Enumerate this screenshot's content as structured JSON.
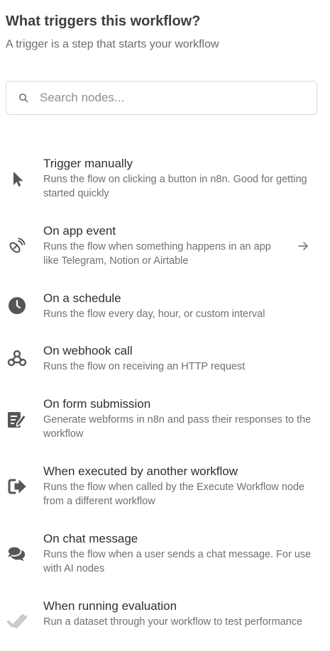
{
  "header": {
    "title": "What triggers this workflow?",
    "subtitle": "A trigger is a step that starts your workflow"
  },
  "search": {
    "placeholder": "Search nodes...",
    "value": "",
    "icon": "search-icon"
  },
  "triggers": [
    {
      "title": "Trigger manually",
      "description": "Runs the flow on clicking a button in n8n. Good for getting started quickly",
      "icon": "cursor-pointer-icon"
    },
    {
      "title": "On app event",
      "description": "Runs the flow when something happens in an app like Telegram, Notion or Airtable",
      "icon": "satellite-dish-icon",
      "has_arrow": true
    },
    {
      "title": "On a schedule",
      "description": "Runs the flow every day, hour, or custom interval",
      "icon": "clock-icon"
    },
    {
      "title": "On webhook call",
      "description": "Runs the flow on receiving an HTTP request",
      "icon": "webhook-icon"
    },
    {
      "title": "On form submission",
      "description": "Generate webforms in n8n and pass their responses to the workflow",
      "icon": "form-edit-icon"
    },
    {
      "title": "When executed by another workflow",
      "description": "Runs the flow when called by the Execute Workflow node from a different workflow",
      "icon": "sign-out-icon"
    },
    {
      "title": "On chat message",
      "description": "Runs the flow when a user sends a chat message. For use with AI nodes",
      "icon": "chat-bubbles-icon"
    },
    {
      "title": "When running evaluation",
      "description": "Run a dataset through your workflow to test performance",
      "icon": "double-check-icon"
    }
  ],
  "colors": {
    "icon": "#55555b",
    "icon_light": "#c7c7cc",
    "title": "#2f2f33",
    "description": "#6f6f76",
    "border": "#d9d9de"
  }
}
